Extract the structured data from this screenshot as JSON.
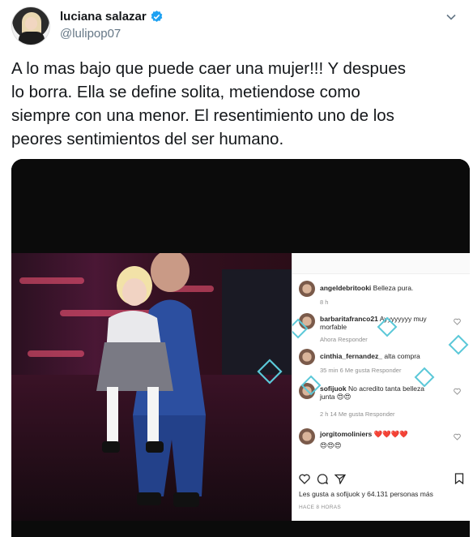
{
  "tweet": {
    "display_name": "luciana salazar",
    "handle": "@lulipop07",
    "verified_icon": "verified-badge-icon",
    "text_lines": [
      "A lo mas bajo que puede caer una mujer!!! Y despues",
      "lo borra. Ella se define solita, metiendose como",
      "siempre con una menor. El resentimiento uno de los",
      "peores sentimientos del ser humano."
    ],
    "accent_color": "#1da1f2"
  },
  "instagram": {
    "comments": [
      {
        "user": "angeldebritooki",
        "text": "Belleza pura.",
        "meta": "8 h"
      },
      {
        "user": "barbaritafranco21",
        "text": "Ayyyyyyyy muy morfable",
        "meta": "Ahora   Responder"
      },
      {
        "user": "cinthia_fernandez_",
        "text": "alta compra",
        "meta": "35 min   6 Me gusta   Responder"
      },
      {
        "user": "sofijuok",
        "text": "No acredito tanta belleza junta 😍😍",
        "meta": "2 h    14 Me gusta    Responder"
      },
      {
        "user": "jorgitomoliniers",
        "text": "❤️❤️❤️❤️",
        "text2": "😍😍😍",
        "meta": ""
      }
    ],
    "likes_text": "Les gusta a sofijuok y 64.131 personas más",
    "likes_user": "sofijuok",
    "likes_count": "64.131",
    "time_text": "HACE 8 HORAS"
  }
}
